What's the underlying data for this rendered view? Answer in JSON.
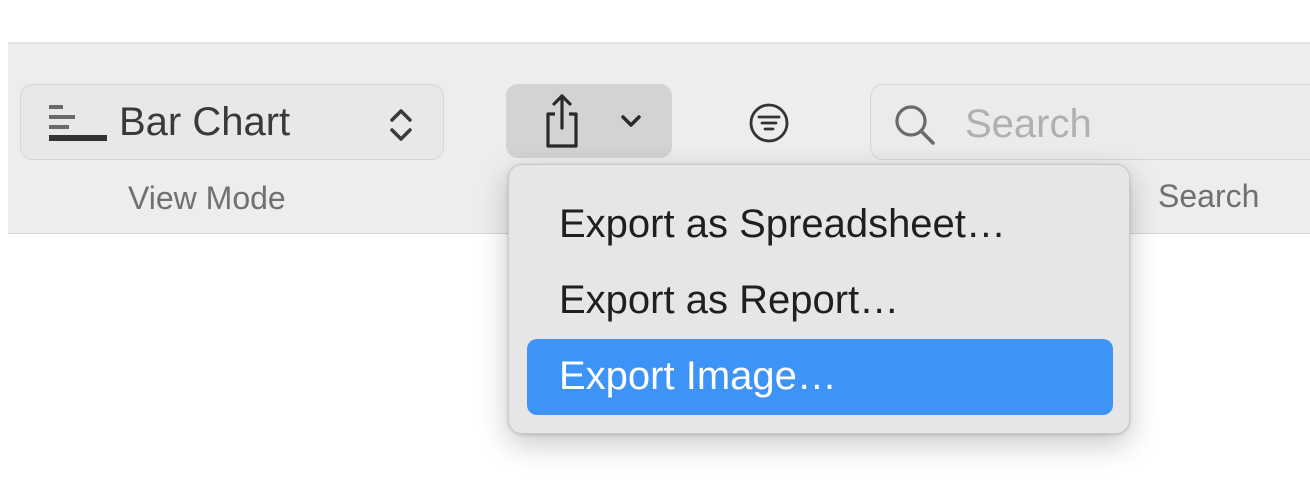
{
  "toolbar": {
    "view_mode": {
      "selected": "Bar Chart",
      "caption": "View Mode",
      "icon": "bar-chart-icon"
    },
    "share": {
      "icon": "share-icon",
      "chevron_icon": "chevron-down-icon",
      "pressed": true
    },
    "filter": {
      "icon": "filter-icon"
    },
    "search": {
      "placeholder": "Search",
      "caption": "Search",
      "icon": "search-icon"
    }
  },
  "export_menu": {
    "items": [
      {
        "label": "Export as Spreadsheet…",
        "highlighted": false
      },
      {
        "label": "Export as Report…",
        "highlighted": false
      },
      {
        "label": "Export Image…",
        "highlighted": true
      }
    ]
  },
  "colors": {
    "highlight": "#3d94f6",
    "toolbar_bg": "#ededed",
    "menu_bg": "#e6e6e6"
  }
}
